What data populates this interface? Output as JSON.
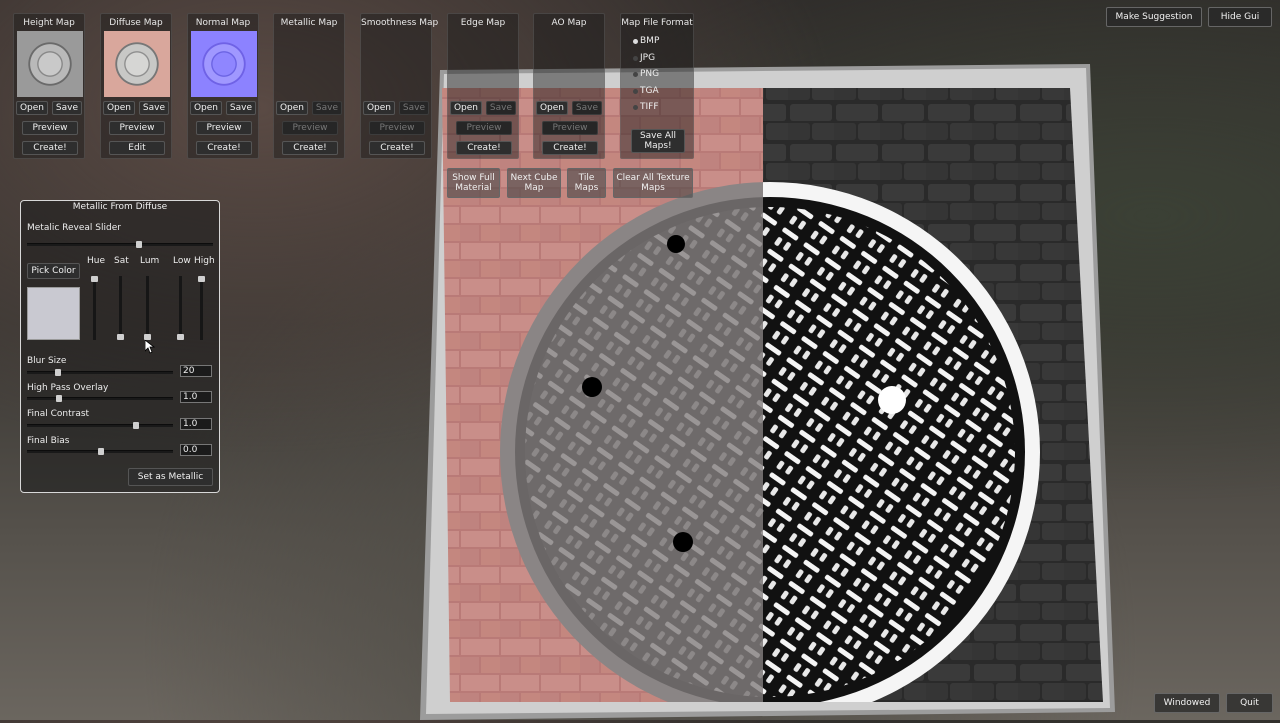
{
  "maps": [
    {
      "title": "Height Map",
      "thumb": "height",
      "open": "Open",
      "save": "Save",
      "save_enabled": true,
      "row1": "Preview",
      "row1_enabled": true,
      "row2": "Create!"
    },
    {
      "title": "Diffuse Map",
      "thumb": "diffuse",
      "open": "Open",
      "save": "Save",
      "save_enabled": true,
      "row1": "Preview",
      "row1_enabled": true,
      "row2": "Edit"
    },
    {
      "title": "Normal Map",
      "thumb": "normal",
      "open": "Open",
      "save": "Save",
      "save_enabled": true,
      "row1": "Preview",
      "row1_enabled": true,
      "row2": "Create!"
    },
    {
      "title": "Metallic Map",
      "thumb": "",
      "open": "Open",
      "save": "Save",
      "save_enabled": false,
      "row1": "Preview",
      "row1_enabled": false,
      "row2": "Create!"
    },
    {
      "title": "Smoothness Map",
      "thumb": "",
      "open": "Open",
      "save": "Save",
      "save_enabled": false,
      "row1": "Preview",
      "row1_enabled": false,
      "row2": "Create!"
    },
    {
      "title": "Edge Map",
      "thumb": "",
      "open": "Open",
      "save": "Save",
      "save_enabled": false,
      "row1": "Preview",
      "row1_enabled": false,
      "row2": "Create!"
    },
    {
      "title": "AO Map",
      "thumb": "",
      "open": "Open",
      "save": "Save",
      "save_enabled": false,
      "row1": "Preview",
      "row1_enabled": false,
      "row2": "Create!"
    }
  ],
  "format": {
    "title": "Map File Format",
    "options": [
      "BMP",
      "JPG",
      "PNG",
      "TGA",
      "TIFF"
    ],
    "selected": "BMP",
    "save_all": "Save All Maps!"
  },
  "actions": [
    {
      "label": "Show Full Material"
    },
    {
      "label": "Next Cube Map"
    },
    {
      "label": "Tile Maps"
    },
    {
      "label": "Clear All Texture Maps"
    }
  ],
  "top_right": {
    "suggest": "Make Suggestion",
    "hide": "Hide Gui"
  },
  "bottom_right": {
    "windowed": "Windowed",
    "quit": "Quit"
  },
  "metallic": {
    "title": "Metallic From Diffuse",
    "reveal_label": "Metalic Reveal Slider",
    "reveal_value": 0.6,
    "pick_color": "Pick Color",
    "swatch_color": "#c9c9d1",
    "col_hue": "Hue",
    "col_sat": "Sat",
    "col_lum": "Lum",
    "col_low": "Low",
    "col_high": "High",
    "blur_label": "Blur Size",
    "blur_value": "20",
    "hp_label": "High Pass Overlay",
    "hp_value": "1.0",
    "contrast_label": "Final Contrast",
    "contrast_value": "1.0",
    "bias_label": "Final Bias",
    "bias_value": "0.0",
    "set_button": "Set as Metallic"
  }
}
